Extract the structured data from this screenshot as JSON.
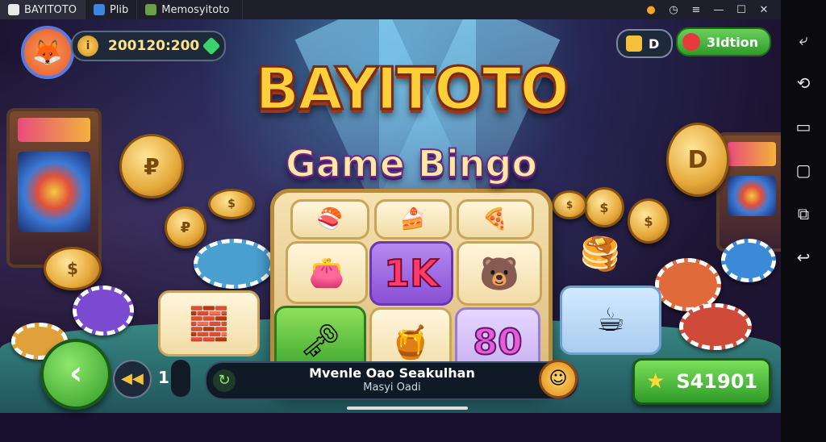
{
  "window": {
    "tabs": [
      {
        "label": "BAYITOTO",
        "icon": "app-icon"
      },
      {
        "label": "Plib",
        "icon": "home-icon"
      },
      {
        "label": "Memosyitoto",
        "icon": "game-icon"
      }
    ],
    "controls": [
      "location-icon",
      "clock-icon",
      "menu-icon",
      "minimize-icon",
      "maximize-icon",
      "close-icon"
    ]
  },
  "hud": {
    "coins": "200120:200",
    "coin_icon_glyph": "i",
    "small_button_label": "D",
    "option_button_label": "3Idtion"
  },
  "game": {
    "title": "BAYITOTO",
    "subtitle": "Game Bingo",
    "tiles": [
      "1K",
      "80"
    ]
  },
  "footer": {
    "page": "1",
    "message_line1": "Mvenle Oao Seakulhan",
    "message_line2": "Masyi Oadi",
    "score": "S41901"
  },
  "android_nav": [
    "screenshot-icon",
    "rotate-icon",
    "fullscreen-icon",
    "window-icon",
    "copy-icon",
    "back-icon"
  ],
  "colors": {
    "accent": "#2f9a2a",
    "title": "#ffcf3a",
    "hud_bg": "#1e2a3a"
  }
}
